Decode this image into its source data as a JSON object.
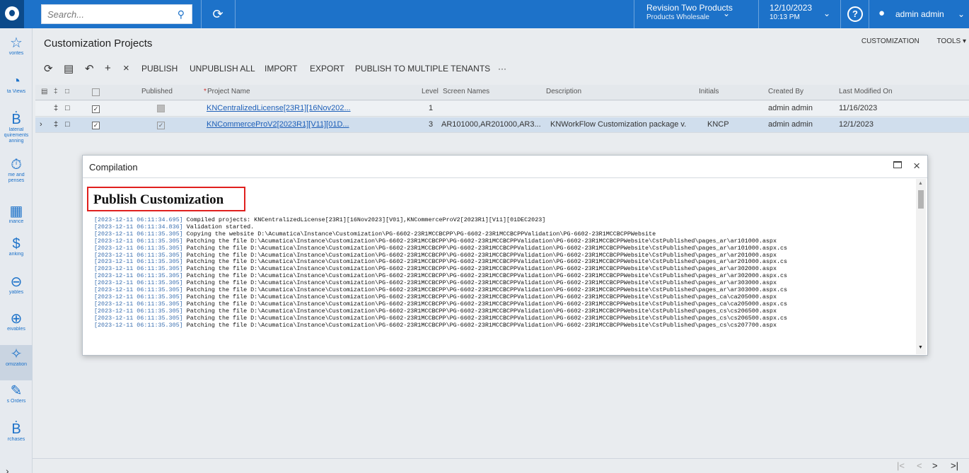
{
  "topbar": {
    "search_placeholder": "Search...",
    "company_line1": "Revision Two Products",
    "company_line2": "Products Wholesale",
    "date": "12/10/2023",
    "time": "10:13 PM",
    "user": "admin admin"
  },
  "nav": [
    {
      "label": "vorites",
      "icon": "star-icon"
    },
    {
      "label": "ta Views",
      "icon": "pie-chart-icon"
    },
    {
      "label": "laterial\nquirements\nanning",
      "icon": "cart-icon"
    },
    {
      "label": "me and\npenses",
      "icon": "stopwatch-icon"
    },
    {
      "label": "inance",
      "icon": "calculator-icon"
    },
    {
      "label": "anking",
      "icon": "dollar-icon"
    },
    {
      "label": "yables",
      "icon": "minus-circle-icon"
    },
    {
      "label": "eivables",
      "icon": "plus-circle-icon"
    },
    {
      "label": "omization",
      "icon": "puzzle-icon"
    },
    {
      "label": "s Orders",
      "icon": "edit-icon"
    },
    {
      "label": "rchases",
      "icon": "cart-icon"
    }
  ],
  "page": {
    "title": "Customization Projects",
    "link_customization": "CUSTOMIZATION",
    "link_tools": "TOOLS ▾"
  },
  "toolbar": {
    "publish": "PUBLISH",
    "unpublish_all": "UNPUBLISH ALL",
    "import": "IMPORT",
    "export": "EXPORT",
    "publish_multi": "PUBLISH TO MULTIPLE TENANTS",
    "more": "···"
  },
  "grid": {
    "headers": {
      "published": "Published",
      "project_name": "Project Name",
      "required_mark": "*",
      "level": "Level",
      "screen_names": "Screen Names",
      "description": "Description",
      "initials": "Initials",
      "created_by": "Created By",
      "last_modified": "Last Modified On"
    },
    "rows": [
      {
        "project_name": "KNCentralizedLicense[23R1][16Nov202...",
        "level": "1",
        "screen_names": "",
        "description": "",
        "initials": "",
        "created_by": "admin admin",
        "last_modified": "11/16/2023",
        "selected": true,
        "published": false
      },
      {
        "project_name": "KNCommerceProV2[2023R1][V11][01D...",
        "level": "3",
        "screen_names": "AR101000,AR201000,AR3...",
        "description": "KNWorkFlow Customization package v...",
        "initials": "KNCP",
        "created_by": "admin admin",
        "last_modified": "12/1/2023",
        "selected": true,
        "published": true
      }
    ]
  },
  "dialog": {
    "title": "Compilation",
    "heading": "Publish Customization",
    "log": [
      {
        "ts": "[2023-12-11 06:11:34.695]",
        "msg": "Compiled projects: KNCentralizedLicense[23R1][16Nov2023][V01],KNCommerceProV2[2023R1][V11][01DEC2023]"
      },
      {
        "ts": "[2023-12-11 06:11:34.836]",
        "msg": "Validation started."
      },
      {
        "ts": "[2023-12-11 06:11:35.305]",
        "msg": "Copying the website D:\\Acumatica\\Instance\\Customization\\PG-6602-23R1MCCBCPP\\PG-6602-23R1MCCBCPPValidation\\PG-6602-23R1MCCBCPPWebsite"
      },
      {
        "ts": "[2023-12-11 06:11:35.305]",
        "msg": "Patching the file D:\\Acumatica\\Instance\\Customization\\PG-6602-23R1MCCBCPP\\PG-6602-23R1MCCBCPPValidation\\PG-6602-23R1MCCBCPPWebsite\\CstPublished\\pages_ar\\ar101000.aspx"
      },
      {
        "ts": "[2023-12-11 06:11:35.305]",
        "msg": "Patching the file D:\\Acumatica\\Instance\\Customization\\PG-6602-23R1MCCBCPP\\PG-6602-23R1MCCBCPPValidation\\PG-6602-23R1MCCBCPPWebsite\\CstPublished\\pages_ar\\ar101000.aspx.cs"
      },
      {
        "ts": "[2023-12-11 06:11:35.305]",
        "msg": "Patching the file D:\\Acumatica\\Instance\\Customization\\PG-6602-23R1MCCBCPP\\PG-6602-23R1MCCBCPPValidation\\PG-6602-23R1MCCBCPPWebsite\\CstPublished\\pages_ar\\ar201000.aspx"
      },
      {
        "ts": "[2023-12-11 06:11:35.305]",
        "msg": "Patching the file D:\\Acumatica\\Instance\\Customization\\PG-6602-23R1MCCBCPP\\PG-6602-23R1MCCBCPPValidation\\PG-6602-23R1MCCBCPPWebsite\\CstPublished\\pages_ar\\ar201000.aspx.cs"
      },
      {
        "ts": "[2023-12-11 06:11:35.305]",
        "msg": "Patching the file D:\\Acumatica\\Instance\\Customization\\PG-6602-23R1MCCBCPP\\PG-6602-23R1MCCBCPPValidation\\PG-6602-23R1MCCBCPPWebsite\\CstPublished\\pages_ar\\ar302000.aspx"
      },
      {
        "ts": "[2023-12-11 06:11:35.305]",
        "msg": "Patching the file D:\\Acumatica\\Instance\\Customization\\PG-6602-23R1MCCBCPP\\PG-6602-23R1MCCBCPPValidation\\PG-6602-23R1MCCBCPPWebsite\\CstPublished\\pages_ar\\ar302000.aspx.cs"
      },
      {
        "ts": "[2023-12-11 06:11:35.305]",
        "msg": "Patching the file D:\\Acumatica\\Instance\\Customization\\PG-6602-23R1MCCBCPP\\PG-6602-23R1MCCBCPPValidation\\PG-6602-23R1MCCBCPPWebsite\\CstPublished\\pages_ar\\ar303000.aspx"
      },
      {
        "ts": "[2023-12-11 06:11:35.305]",
        "msg": "Patching the file D:\\Acumatica\\Instance\\Customization\\PG-6602-23R1MCCBCPP\\PG-6602-23R1MCCBCPPValidation\\PG-6602-23R1MCCBCPPWebsite\\CstPublished\\pages_ar\\ar303000.aspx.cs"
      },
      {
        "ts": "[2023-12-11 06:11:35.305]",
        "msg": "Patching the file D:\\Acumatica\\Instance\\Customization\\PG-6602-23R1MCCBCPP\\PG-6602-23R1MCCBCPPValidation\\PG-6602-23R1MCCBCPPWebsite\\CstPublished\\pages_ca\\ca205000.aspx"
      },
      {
        "ts": "[2023-12-11 06:11:35.305]",
        "msg": "Patching the file D:\\Acumatica\\Instance\\Customization\\PG-6602-23R1MCCBCPP\\PG-6602-23R1MCCBCPPValidation\\PG-6602-23R1MCCBCPPWebsite\\CstPublished\\pages_ca\\ca205000.aspx.cs"
      },
      {
        "ts": "[2023-12-11 06:11:35.305]",
        "msg": "Patching the file D:\\Acumatica\\Instance\\Customization\\PG-6602-23R1MCCBCPP\\PG-6602-23R1MCCBCPPValidation\\PG-6602-23R1MCCBCPPWebsite\\CstPublished\\pages_cs\\cs206500.aspx"
      },
      {
        "ts": "[2023-12-11 06:11:35.305]",
        "msg": "Patching the file D:\\Acumatica\\Instance\\Customization\\PG-6602-23R1MCCBCPP\\PG-6602-23R1MCCBCPPValidation\\PG-6602-23R1MCCBCPPWebsite\\CstPublished\\pages_cs\\cs206500.aspx.cs"
      },
      {
        "ts": "[2023-12-11 06:11:35.305]",
        "msg": "Patching the file D:\\Acumatica\\Instance\\Customization\\PG-6602-23R1MCCBCPP\\PG-6602-23R1MCCBCPPValidation\\PG-6602-23R1MCCBCPPWebsite\\CstPublished\\pages_cs\\cs207700.aspx"
      }
    ]
  },
  "colors": {
    "topbar": "#1d72c9",
    "logo_bg": "#0c4a8a",
    "highlight_box": "#e0201e",
    "selected_row": "#d0deed",
    "link": "#1d5fb8"
  }
}
